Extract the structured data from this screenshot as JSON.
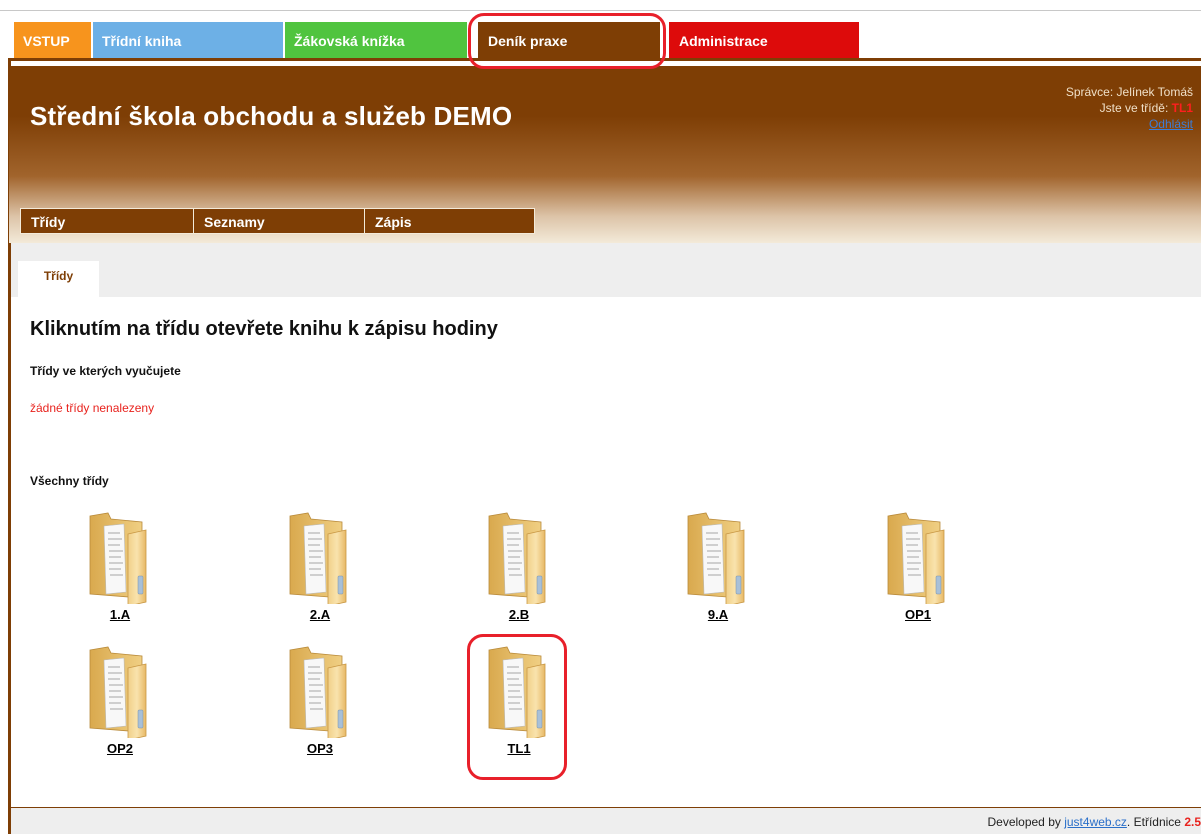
{
  "modules": {
    "vstup": "VSTUP",
    "tridni_kniha": "Třídní kniha",
    "zakovska_knizka": "Žákovská knížka",
    "denik_praxe": "Deník praxe",
    "administrace": "Administrace"
  },
  "header": {
    "school_name": "Střední škola obchodu a služeb DEMO",
    "user_prefix": "Správce:",
    "user_name": "Jelínek Tomáš",
    "class_prefix": "Jste ve třídě:",
    "class_name": "TL1",
    "logout": "Odhlásit"
  },
  "subnav": [
    "Třídy",
    "Seznamy",
    "Zápis"
  ],
  "tabs": [
    "Třídy"
  ],
  "content": {
    "title": "Kliknutím na třídu otevřete knihu k zápisu hodiny",
    "section_teaching": "Třídy ve kterých vyučujete",
    "no_classes": "žádné třídy nenalezeny",
    "section_all": "Všechny třídy"
  },
  "classes": [
    "1.A",
    "2.A",
    "2.B",
    "9.A",
    "OP1",
    "OP2",
    "OP3",
    "TL1"
  ],
  "footer": {
    "developed_by": "Developed by",
    "link": "just4web.cz",
    "product": "Etřídnice",
    "version": "2.5"
  },
  "colors": {
    "brand_brown": "#7e3e05",
    "tab_orange": "#f7941d",
    "tab_blue": "#6db0e6",
    "tab_green": "#50c43f",
    "tab_red": "#dd0b0b",
    "highlight": "#e8202a"
  }
}
